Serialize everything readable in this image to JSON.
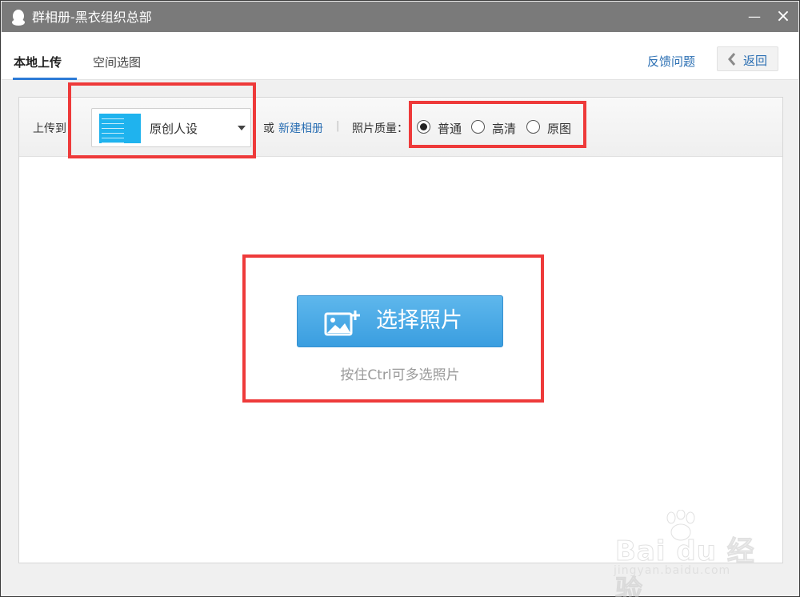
{
  "window": {
    "title": "群相册-黑衣组织总部",
    "minimize_glyph": "—",
    "close_glyph": "×"
  },
  "tabs": {
    "local_upload": "本地上传",
    "space_select": "空间选图",
    "feedback": "反馈问题",
    "back": "返回"
  },
  "toolbar": {
    "upload_to_label": "上传到：",
    "album_name": "原创人设",
    "or_text": "或",
    "new_album": "新建相册",
    "separator": "|",
    "quality_label": "照片质量：",
    "quality_options": [
      {
        "label": "普通",
        "checked": true
      },
      {
        "label": "高清",
        "checked": false
      },
      {
        "label": "原图",
        "checked": false
      }
    ]
  },
  "dropzone": {
    "select_button": "选择照片",
    "hint": "按住Ctrl可多选照片"
  },
  "watermark": {
    "logo": "Bai du 经验",
    "url": "jingyan.baidu.com"
  },
  "colors": {
    "accent_blue": "#2b6fb3",
    "button_blue": "#3a9ee0",
    "annotation_red": "#ee3a3a",
    "titlebar": "#7a7a7a"
  },
  "icons": {
    "app": "qq-penguin-icon",
    "back": "chevron-left-icon",
    "photo": "add-photo-icon",
    "dropdown": "caret-down-icon"
  }
}
